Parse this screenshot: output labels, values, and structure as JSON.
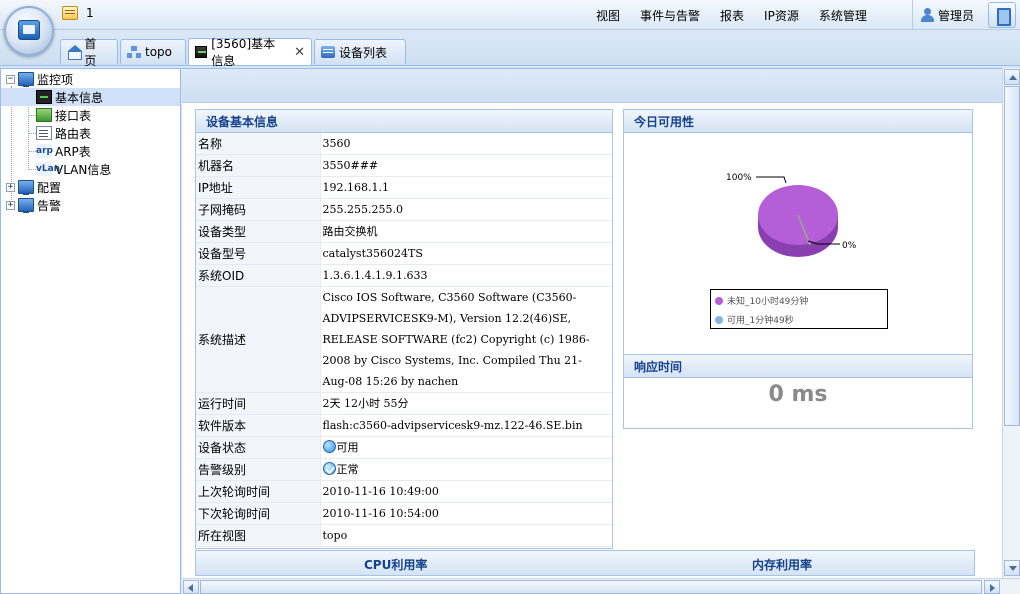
{
  "header": {
    "message_count": "1",
    "menus": [
      "视图",
      "事件与告警",
      "报表",
      "IP资源",
      "系统管理"
    ],
    "user": "管理员"
  },
  "tabs": [
    {
      "label": "首 页",
      "icon": "home-icon"
    },
    {
      "label": "topo",
      "icon": "topology-icon"
    },
    {
      "label": "[3560]基本信息",
      "icon": "device-icon",
      "close": "✕"
    },
    {
      "label": "设备列表",
      "icon": "device-list-icon"
    }
  ],
  "tree": {
    "monitor": "监控项",
    "items": [
      "基本信息",
      "接口表",
      "路由表",
      "ARP表",
      "VLAN信息"
    ],
    "icon_texts": {
      "arp": "arp",
      "vlan": "vLan"
    },
    "config": "配置",
    "alarm": "告警",
    "expand_minus": "−",
    "expand_plus": "+"
  },
  "info_panel": {
    "title": "设备基本信息",
    "rows": [
      {
        "k": "名称",
        "v": "3560"
      },
      {
        "k": "机器名",
        "v": "3550###"
      },
      {
        "k": "IP地址",
        "v": "192.168.1.1"
      },
      {
        "k": "子网掩码",
        "v": "255.255.255.0"
      },
      {
        "k": "设备类型",
        "v": "路由交换机"
      },
      {
        "k": "设备型号",
        "v": "catalyst356024TS"
      },
      {
        "k": "系统OID",
        "v": "1.3.6.1.4.1.9.1.633"
      },
      {
        "k": "系统描述",
        "v": "Cisco IOS Software, C3560 Software (C3560-ADVIPSERVICESK9-M), Version 12.2(46)SE, RELEASE SOFTWARE (fc2) Copyright (c) 1986-2008 by Cisco Systems, Inc. Compiled Thu 21-Aug-08 15:26 by nachen"
      },
      {
        "k": "运行时间",
        "v": "2天 12小时 55分"
      },
      {
        "k": "软件版本",
        "v": "flash:c3560-advipservicesk9-mz.122-46.SE.bin"
      },
      {
        "k": "设备状态",
        "v": "可用"
      },
      {
        "k": "告警级别",
        "v": "正常"
      },
      {
        "k": "上次轮询时间",
        "v": "2010-11-16 10:49:00"
      },
      {
        "k": "下次轮询时间",
        "v": "2010-11-16 10:54:00"
      },
      {
        "k": "所在视图",
        "v": "topo"
      }
    ]
  },
  "availability": {
    "title": "今日可用性",
    "label_100": "100%",
    "label_0": "0%",
    "legend": [
      {
        "label": "未知_10小时49分钟",
        "color": "#b45fd8"
      },
      {
        "label": "可用_1分钟49秒",
        "color": "#7fb3e8"
      }
    ]
  },
  "chart_data": {
    "type": "pie",
    "categories": [
      "未知_10小时49分钟",
      "可用_1分钟49秒"
    ],
    "values": [
      100,
      0
    ]
  },
  "response": {
    "title": "响应时间",
    "value": "0 ms"
  },
  "bottom": {
    "cpu": "CPU利用率",
    "mem": "内存利用率"
  },
  "colors": {
    "accent": "#15428b",
    "panel_border": "#a9c3e3",
    "pie_main": "#b45fd8"
  }
}
